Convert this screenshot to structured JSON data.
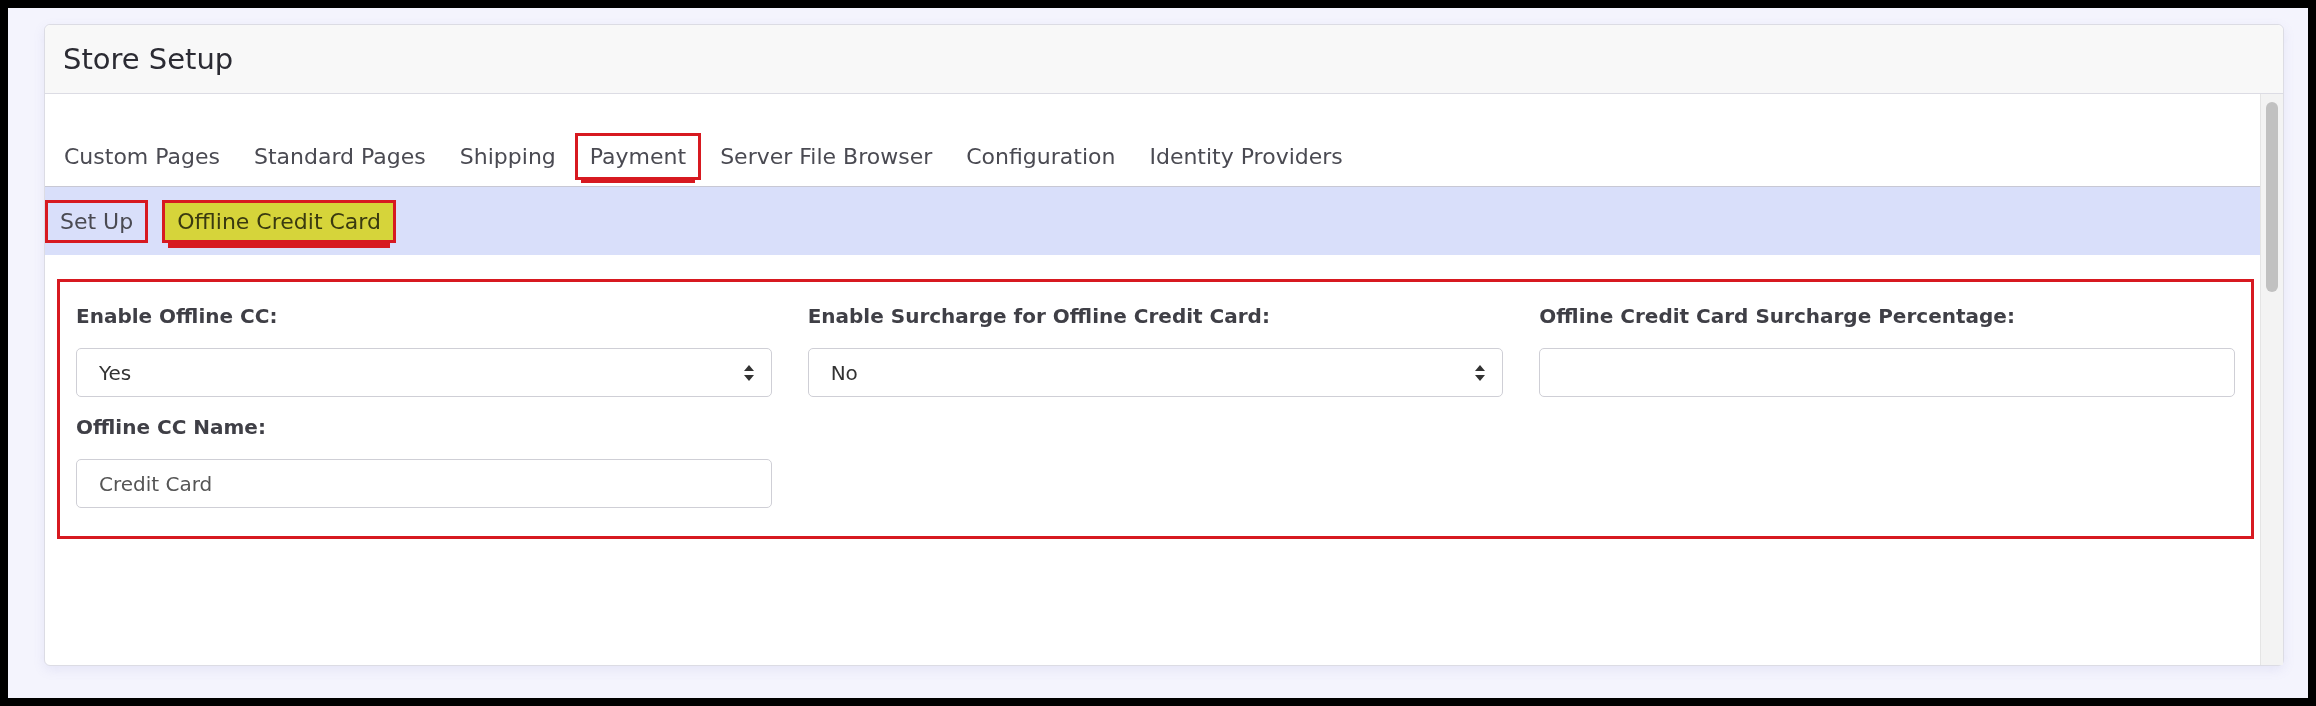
{
  "panel": {
    "title": "Store Setup"
  },
  "tabs": [
    {
      "label": "Custom Pages",
      "selected": false,
      "outlined": false
    },
    {
      "label": "Standard Pages",
      "selected": false,
      "outlined": false
    },
    {
      "label": "Shipping",
      "selected": false,
      "outlined": false
    },
    {
      "label": "Payment",
      "selected": true,
      "outlined": true
    },
    {
      "label": "Server File Browser",
      "selected": false,
      "outlined": false
    },
    {
      "label": "Configuration",
      "selected": false,
      "outlined": false
    },
    {
      "label": "Identity Providers",
      "selected": false,
      "outlined": false
    }
  ],
  "subtabs": [
    {
      "label": "Set Up",
      "selected": false,
      "outlined": true,
      "highlighted": false
    },
    {
      "label": "Offline Credit Card",
      "selected": true,
      "outlined": true,
      "highlighted": true
    }
  ],
  "form": {
    "outlined": true,
    "fields": [
      {
        "kind": "select",
        "label": "Enable Offline CC:",
        "value": "Yes"
      },
      {
        "kind": "select",
        "label": "Enable Surcharge for Offline Credit Card:",
        "value": "No"
      },
      {
        "kind": "text",
        "label": "Offline Credit Card Surcharge Percentage:"
      },
      {
        "kind": "text",
        "label": "Offline CC Name:",
        "value": "Credit Card"
      }
    ]
  }
}
